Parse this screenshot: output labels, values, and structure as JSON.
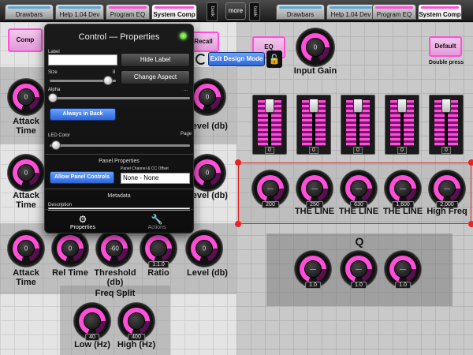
{
  "tabs_left": [
    {
      "label": "Drawbars",
      "strip": "#59a7d9"
    },
    {
      "label": "Help 1.04 Dev",
      "strip": "#59a7d9"
    },
    {
      "label": "Program EQ",
      "strip": "#ff4fd8"
    },
    {
      "label": "System Comp",
      "strip": "#ff4fd8"
    }
  ],
  "tabs_right": [
    {
      "label": "Drawbars",
      "strip": "#59a7d9"
    },
    {
      "label": "Help 1.04 Dev",
      "strip": "#59a7d9"
    },
    {
      "label": "Program EQ",
      "strip": "#ff4fd8"
    },
    {
      "label": "System Comp",
      "strip": "#ff4fd8"
    }
  ],
  "bank_label": "bank",
  "more_label": "more",
  "left": {
    "comp_button": "Comp",
    "recall_button": "Recall",
    "row1": {
      "attack_label": "Attack Time",
      "level_label": "Level (db)",
      "attack_value": "0",
      "level_value": "0"
    },
    "row2": {
      "attack_label": "Attack Time",
      "level_label": "Level (db)",
      "attack_value": "0",
      "level_value": "0"
    },
    "row3": [
      {
        "label": "Attack Time",
        "value": "0",
        "badge": ""
      },
      {
        "label": "Rel Time",
        "value": "0",
        "badge": ""
      },
      {
        "label": "Threshold (db)",
        "value": "-60",
        "badge": ""
      },
      {
        "label": "Ratio",
        "value": "",
        "badge": "1:1.0"
      },
      {
        "label": "Level (db)",
        "value": "0",
        "badge": ""
      }
    ],
    "freq_split": {
      "title": "Freq Split",
      "low_label": "Low (Hz)",
      "low_badge": "40",
      "high_label": "High (Hz)",
      "high_badge": "400"
    }
  },
  "popover": {
    "title": "Control — Properties",
    "label_field_label": "Label",
    "label_value": "",
    "hide_label_button": "Hide Label",
    "size_label": "Size",
    "size_value": "8",
    "size_level": 0.9,
    "change_aspect_button": "Change Aspect",
    "alpha_label": "Alpha",
    "alpha_value": "...",
    "alpha_level": 0.0,
    "always_in_back_button": "Always in Back",
    "led_color_label": "LED Color",
    "page_label": "Page",
    "panel_properties_title": "Panel Properties",
    "allow_panel_controls_button": "Allow Panel Controls",
    "panel_channel_label": "Panel Channel & CC Offset",
    "panel_channel_value": "None - None",
    "metadata_title": "Metadata",
    "description_label": "Description",
    "tab_properties": "Properties",
    "tab_actions": "Actions"
  },
  "right": {
    "eq_button": "EQ",
    "input_gain_label": "Input Gain",
    "input_gain_value": "0",
    "default_button": "Default",
    "double_press_label": "Double press",
    "exit_design_button": "Exit Design Mode",
    "faders": [
      {
        "value": "0",
        "level": 0.0
      },
      {
        "value": "0",
        "level": 0.0
      },
      {
        "value": "0",
        "level": 0.0
      },
      {
        "value": "0",
        "level": 0.0
      },
      {
        "value": "0",
        "level": 0.0
      }
    ],
    "eq_knobs": [
      {
        "badge": "200",
        "label": "",
        "value": "—"
      },
      {
        "badge": "250",
        "label": "THE LINE",
        "value": "—"
      },
      {
        "badge": "630",
        "label": "THE LINE",
        "value": "—"
      },
      {
        "badge": "1,600",
        "label": "THE LINE",
        "value": "—"
      },
      {
        "badge": "2,000",
        "label": "High Freq",
        "value": "—"
      }
    ],
    "q_label": "Q",
    "q_knobs": [
      {
        "badge": "1.0",
        "value": "—"
      },
      {
        "badge": "1.0",
        "value": "—"
      },
      {
        "badge": "1.0",
        "value": "—"
      }
    ]
  }
}
